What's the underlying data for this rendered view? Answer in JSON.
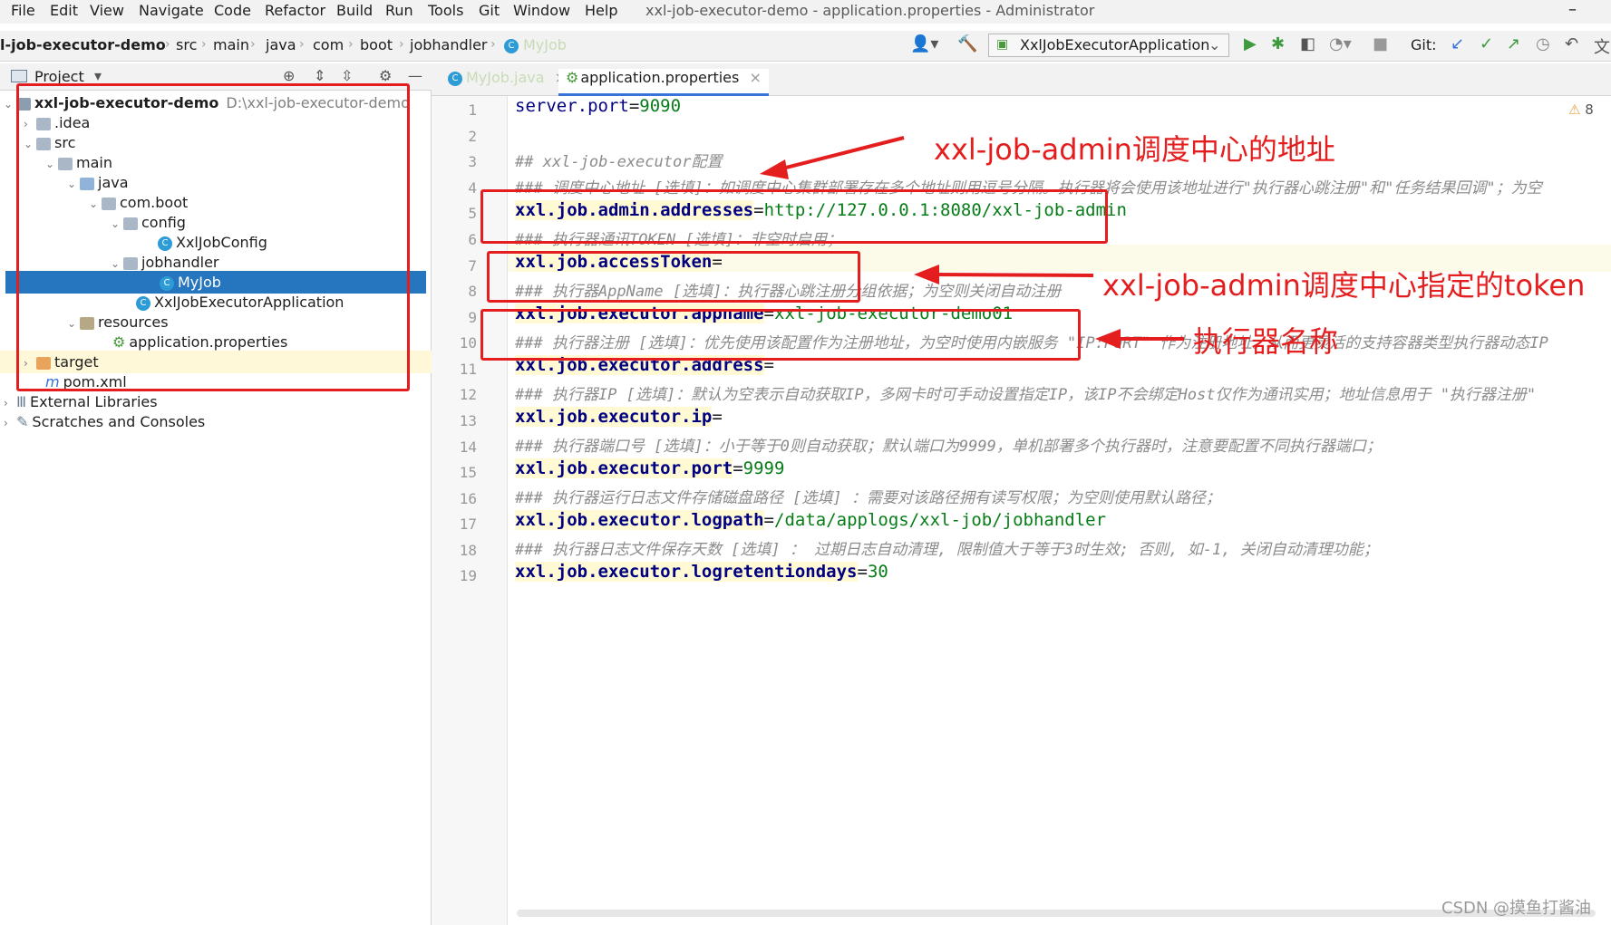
{
  "menu": {
    "items": [
      "File",
      "Edit",
      "View",
      "Navigate",
      "Code",
      "Refactor",
      "Build",
      "Run",
      "Tools",
      "Git",
      "Window",
      "Help"
    ],
    "window_title": "xxl-job-executor-demo - application.properties - Administrator",
    "minimize": "–"
  },
  "breadcrumb": {
    "project": "l-job-executor-demo",
    "items": [
      "src",
      "main",
      "java",
      "com",
      "boot",
      "jobhandler"
    ],
    "current": "MyJob"
  },
  "toolbar": {
    "run_config": "XxlJobExecutorApplication",
    "git_label": "Git:"
  },
  "project_panel": {
    "title": "Project",
    "root_path": "D:\\xxl-job-executor-demo",
    "tree": [
      "xxl-job-executor-demo",
      ".idea",
      "src",
      "main",
      "java",
      "com.boot",
      "config",
      "XxlJobConfig",
      "jobhandler",
      "MyJob",
      "XxlJobExecutorApplication",
      "resources",
      "application.properties",
      "target",
      "pom.xml",
      "External Libraries",
      "Scratches and Consoles"
    ]
  },
  "tabs": [
    {
      "label": "MyJob.java",
      "active": false
    },
    {
      "label": "application.properties",
      "active": true
    }
  ],
  "editor": {
    "warning_count": "8",
    "line_numbers": [
      "1",
      "2",
      "3",
      "4",
      "5",
      "6",
      "7",
      "8",
      "9",
      "10",
      "11",
      "12",
      "13",
      "14",
      "15",
      "16",
      "17",
      "18",
      "19"
    ],
    "lines": {
      "l1_key": "server.port",
      "l1_val": "9090",
      "l3_cmt": "## xxl-job-executor配置",
      "l4_cmt": "### 调度中心地址 [选填]：如调度中心集群部署存在多个地址则用逗号分隔。执行器将会使用该地址进行\"执行器心跳注册\"和\"任务结果回调\"；为空",
      "l5_key": "xxl.job.admin.addresses",
      "l5_val": "http://127.0.0.1:8080/xxl-job-admin",
      "l6_cmt": "### 执行器通讯TOKEN [选填]：非空时启用；",
      "l7_key": "xxl.job.accessToken",
      "l7_val": "",
      "l8_cmt": "### 执行器AppName [选填]：执行器心跳注册分组依据；为空则关闭自动注册",
      "l9_key": "xxl.job.executor.appname",
      "l9_val": "xxl-job-executor-demo01",
      "l10_cmt": "### 执行器注册 [选填]：优先使用该配置作为注册地址，为空时使用内嵌服务 \"IP:PORT\" 作为注册地址。从而更灵活的支持容器类型执行器动态IP",
      "l11_key": "xxl.job.executor.address",
      "l11_val": "",
      "l12_cmt": "### 执行器IP [选填]：默认为空表示自动获取IP，多网卡时可手动设置指定IP，该IP不会绑定Host仅作为通讯实用；地址信息用于 \"执行器注册\"",
      "l13_key": "xxl.job.executor.ip",
      "l13_val": "",
      "l14_cmt": "### 执行器端口号 [选填]：小于等于0则自动获取；默认端口为9999，单机部署多个执行器时，注意要配置不同执行器端口；",
      "l15_key": "xxl.job.executor.port",
      "l15_val": "9999",
      "l16_cmt": "### 执行器运行日志文件存储磁盘路径 [选填] ：需要对该路径拥有读写权限；为空则使用默认路径；",
      "l17_key": "xxl.job.executor.logpath",
      "l17_val": "/data/applogs/xxl-job/jobhandler",
      "l18_cmt": "### 执行器日志文件保存天数 [选填] ： 过期日志自动清理, 限制值大于等于3时生效; 否则, 如-1, 关闭自动清理功能；",
      "l19_key": "xxl.job.executor.logretentiondays",
      "l19_val": "30"
    }
  },
  "annotations": {
    "admin_address": "xxl-job-admin调度中心的地址",
    "admin_token": "xxl-job-admin调度中心指定的token",
    "executor_name": "执行器名称",
    "color": "#e41e1e"
  },
  "watermark": "CSDN @摸鱼打酱油"
}
